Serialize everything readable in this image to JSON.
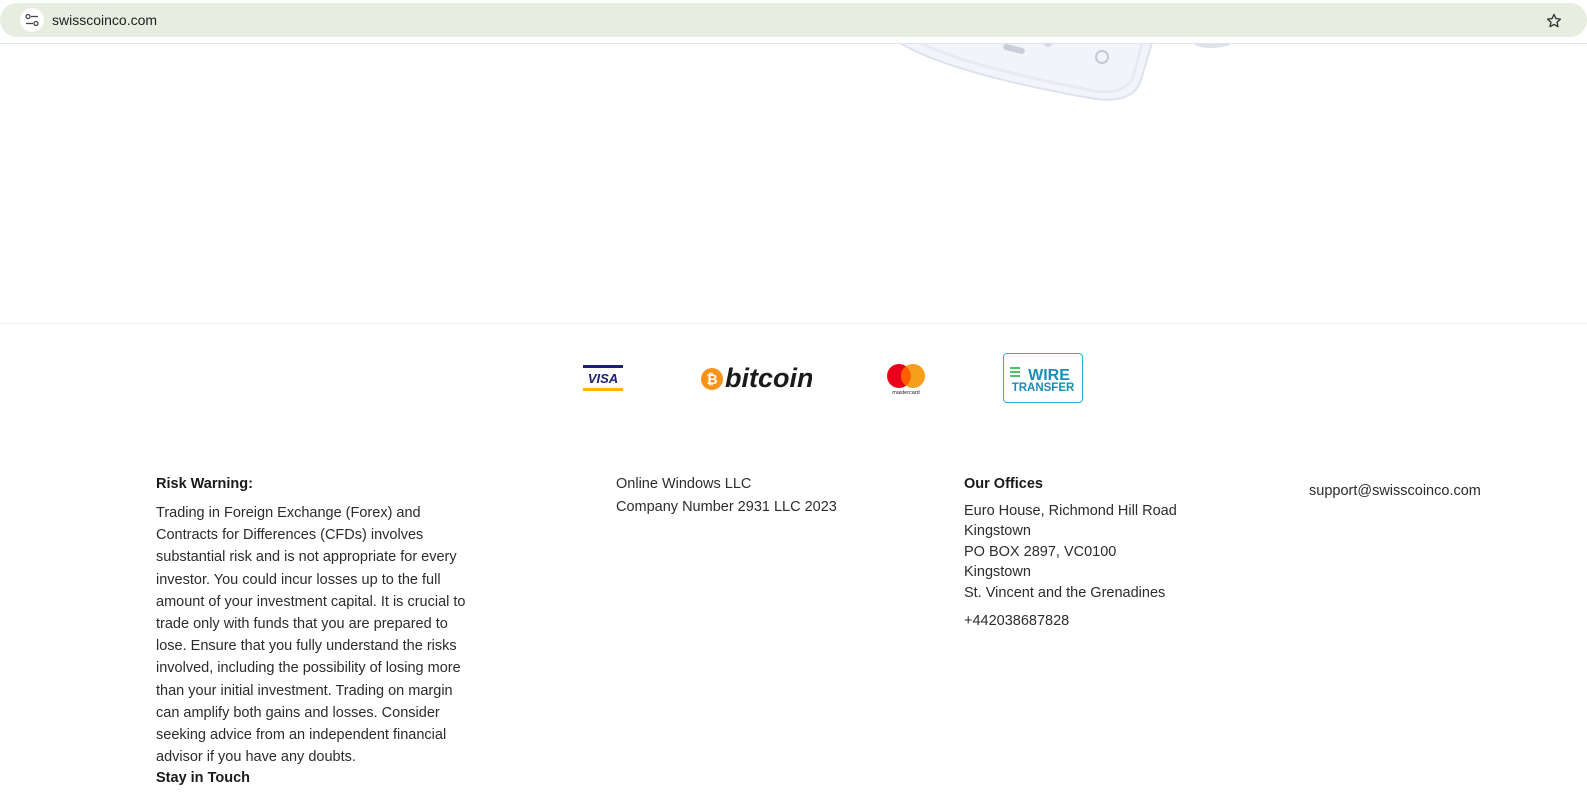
{
  "browser": {
    "url": "swisscoinco.com"
  },
  "payments": {
    "visa_text": "VISA",
    "bitcoin_text": "bitcoin",
    "mastercard_text": "mastercard",
    "wire_line1": "WIRE",
    "wire_line2": "TRANSFER"
  },
  "footer": {
    "risk_heading": "Risk Warning:",
    "risk_body": "Trading in Foreign Exchange (Forex) and Contracts for Differences (CFDs) involves substantial risk and is not appropriate for every investor. You could incur losses up to the full amount of your investment capital. It is crucial to trade only with funds that you are prepared to lose. Ensure that you fully understand the risks involved, including the possibility of losing more than your initial investment. Trading on margin can amplify both gains and losses. Consider seeking advice from an independent financial advisor if you have any doubts.",
    "stay_heading": "Stay in Touch",
    "company_name": "Online Windows LLC",
    "company_number": "Company Number 2931 LLC 2023",
    "offices_heading": "Our Offices",
    "address_lines": [
      "Euro House, Richmond Hill Road",
      "Kingstown",
      "PO BOX 2897, VC0100",
      "Kingstown",
      "St. Vincent and the Grenadines"
    ],
    "phone": "+442038687828",
    "email": "support@swisscoinco.com"
  },
  "colors": {
    "omnibox_bg": "#e7eedf",
    "visa_blue": "#1a1f71",
    "visa_gold": "#f7b600",
    "bitcoin_orange": "#f7931a",
    "mastercard_red": "#eb001b",
    "mastercard_yellow": "#f79e1b",
    "wire_blue": "#1790b8",
    "wire_green": "#4cc36a"
  }
}
